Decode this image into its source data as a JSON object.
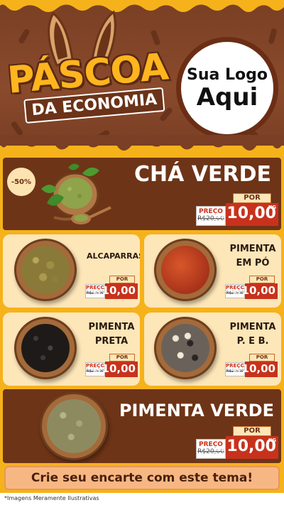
{
  "header": {
    "title": "PÁSCOA",
    "subtitle": "DA ECONOMIA",
    "logo_line1": "Sua Logo",
    "logo_line2": "Aqui"
  },
  "featured_top": {
    "badge": "-50%",
    "name": "CHÁ VERDE",
    "price": {
      "preco_label": "PREÇO",
      "old": "R$20,00",
      "por_label": "POR",
      "currency": "R$",
      "new": "10,00",
      "unit": "KG"
    }
  },
  "products": [
    {
      "name": "ALCAPARRAS",
      "preco_label": "PREÇO",
      "old": "R$20,00",
      "por_label": "POR",
      "currency": "R$",
      "new": "10,00"
    },
    {
      "name_l1": "PIMENTA",
      "name_l2": "EM PÓ",
      "preco_label": "PREÇO",
      "old": "R$20,00",
      "por_label": "POR",
      "currency": "R$",
      "new": "10,00"
    },
    {
      "name_l1": "PIMENTA",
      "name_l2": "PRETA",
      "preco_label": "PREÇO",
      "old": "R$20,00",
      "por_label": "POR",
      "currency": "R$",
      "new": "10,00"
    },
    {
      "name_l1": "PIMENTA",
      "name_l2": "P. E B.",
      "preco_label": "PREÇO",
      "old": "R$20,00",
      "por_label": "POR",
      "currency": "R$",
      "new": "10,00"
    }
  ],
  "featured_bottom": {
    "name": "PIMENTA VERDE",
    "price": {
      "preco_label": "PREÇO",
      "old": "R$20,00",
      "por_label": "POR",
      "currency": "R$",
      "new": "10,00",
      "unit": "KG"
    }
  },
  "cta": "Crie seu encarte com este tema!",
  "disclaimer": "*Imagens Meramente Ilustrativas",
  "colors": {
    "brand_brown": "#6e3417",
    "accent_orange": "#f6b21a",
    "price_red": "#c8321c",
    "card_cream": "#fde6b8"
  },
  "icons": [
    "bunny-ears-icon",
    "green-tea-bowl-icon",
    "capers-bowl-icon",
    "chili-powder-bowl-icon",
    "black-pepper-bowl-icon",
    "mixed-pepper-bowl-icon",
    "green-pepper-bowl-icon"
  ]
}
